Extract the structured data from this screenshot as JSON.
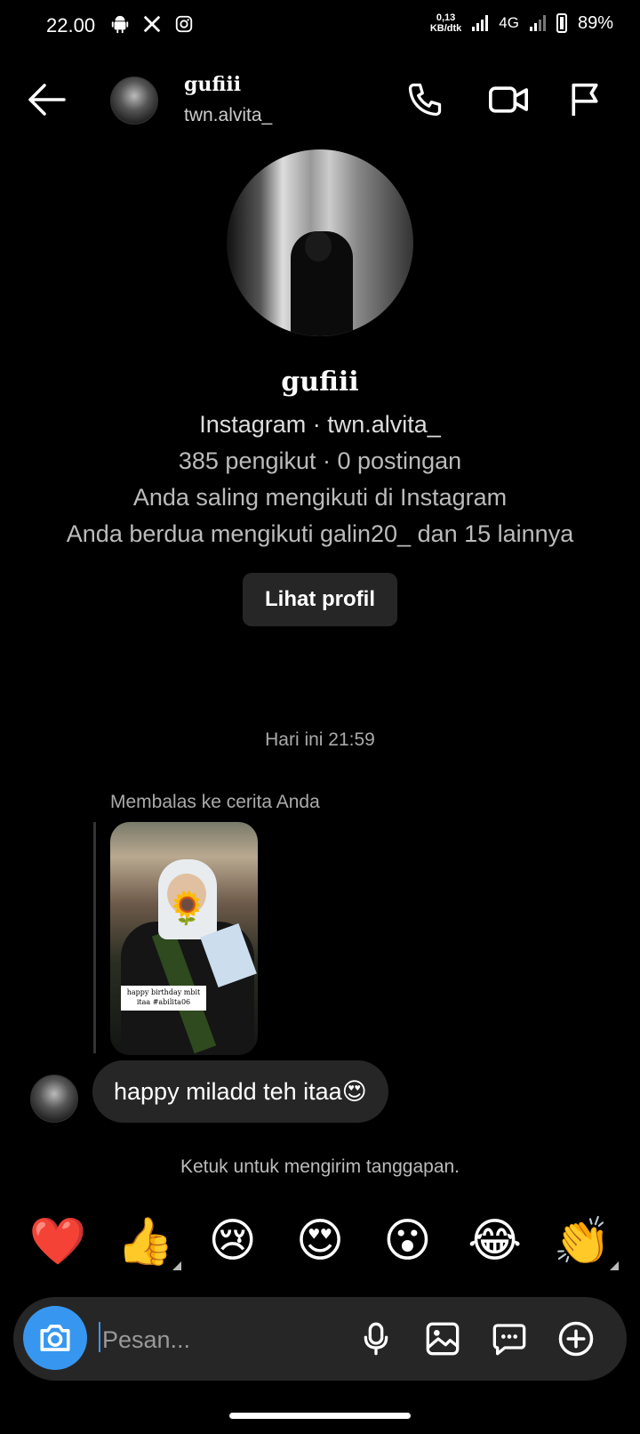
{
  "status_bar": {
    "time": "22.00",
    "icons": [
      "android-icon",
      "x-icon",
      "instagram-icon"
    ],
    "speed_value": "0,13",
    "speed_unit": "KB/dtk",
    "network": "4G",
    "battery": "89%"
  },
  "header": {
    "name": "gufiii",
    "username": "twn.alvita_",
    "icons": [
      "back-arrow-icon",
      "phone-icon",
      "video-icon",
      "flag-icon"
    ]
  },
  "profile": {
    "name": "gufiii",
    "source_line": "Instagram · twn.alvita_",
    "stats_line": "385 pengikut · 0 postingan",
    "mutual_line": "Anda saling mengikuti di Instagram",
    "followers_line": "Anda berdua mengikuti galin20_ dan 15 lainnya",
    "view_profile_button": "Lihat profil"
  },
  "conversation": {
    "timestamp": "Hari ini 21:59",
    "reply_label": "Membalas ke cerita Anda",
    "story_caption": "happy birthday mbit itaa #abilita06",
    "message": "happy miladd teh itaa😍",
    "hint": "Ketuk untuk mengirim tanggapan."
  },
  "reactions": [
    "❤️",
    "👍",
    "😢",
    "😍",
    "😮",
    "😂",
    "👏"
  ],
  "composer": {
    "placeholder": "Pesan...",
    "icons": [
      "camera-icon",
      "microphone-icon",
      "gallery-icon",
      "chat-sticker-icon",
      "plus-icon"
    ],
    "accent": "#3797f0"
  }
}
